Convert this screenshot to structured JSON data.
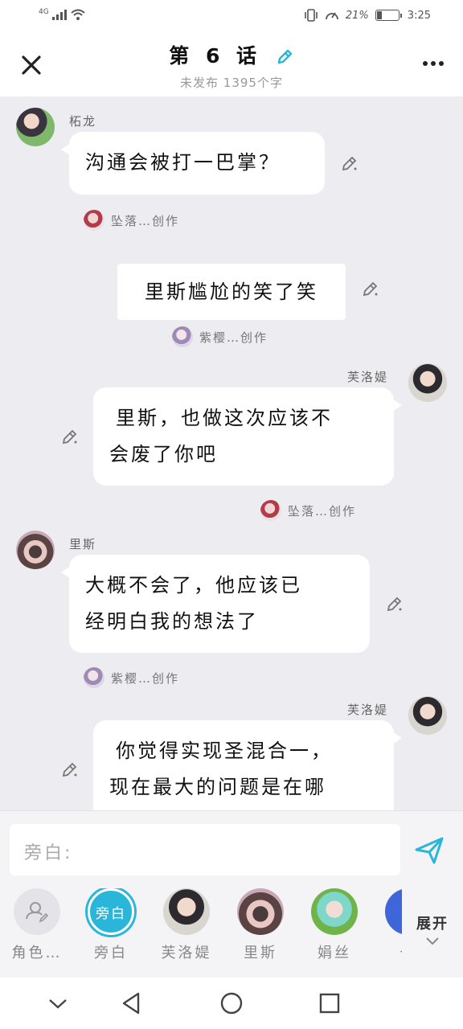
{
  "status": {
    "network": "4G",
    "battery": "21%",
    "battery_level": 0.21,
    "time": "3:25"
  },
  "header": {
    "title": "第 6 话",
    "subtitle": "未发布  1395个字"
  },
  "messages": [
    {
      "speaker": "柘龙",
      "lines": [
        "沟通会被打一巴掌？"
      ],
      "credit": "坠落…创作"
    },
    {
      "narration": "里斯尴尬的笑了笑",
      "credit": "紫樱…创作"
    },
    {
      "speaker": "芙洛媞",
      "lines": [
        "里斯，也做这次应该不",
        "会废了你吧"
      ],
      "credit": "坠落…创作"
    },
    {
      "speaker": "里斯",
      "lines": [
        "大概不会了，他应该已",
        "经明白我的想法了"
      ],
      "credit": "紫樱…创作"
    },
    {
      "speaker": "芙洛媞",
      "lines": [
        "你觉得实现圣混合一，",
        "现在最大的问题是在哪"
      ]
    }
  ],
  "composer": {
    "input_label": "旁白:",
    "roles": [
      {
        "label": "角色…",
        "icon": "person-add-icon"
      },
      {
        "label": "旁白",
        "circle_text": "旁白"
      },
      {
        "label": "芙洛媞"
      },
      {
        "label": "里斯"
      },
      {
        "label": "娟丝"
      },
      {
        "label": "也"
      }
    ],
    "expand_label": "展开"
  },
  "colors": {
    "accent": "#29b6d8",
    "chat_bg": "#ececf1"
  }
}
